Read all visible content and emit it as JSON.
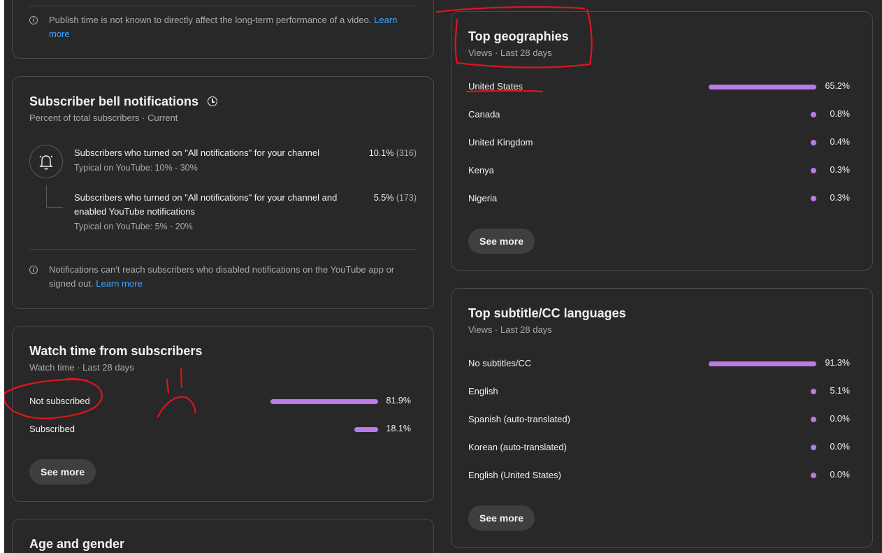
{
  "publish_card": {
    "info_text": "Publish time is not known to directly affect the long-term performance of a video.",
    "learn_more": "Learn more"
  },
  "bell_card": {
    "title": "Subscriber bell notifications",
    "subtitle": "Percent of total subscribers · Current",
    "rows": [
      {
        "text": "Subscribers who turned on \"All notifications\" for your channel",
        "typical": "Typical on YouTube: 10% - 30%",
        "value": "10.1%",
        "count": "(316)"
      },
      {
        "text": "Subscribers who turned on \"All notifications\" for your channel and enabled YouTube notifications",
        "typical": "Typical on YouTube: 5% - 20%",
        "value": "5.5%",
        "count": "(173)"
      }
    ],
    "info_text": "Notifications can't reach subscribers who disabled notifications on the YouTube app or signed out.",
    "learn_more": "Learn more"
  },
  "watch_card": {
    "title": "Watch time from subscribers",
    "subtitle": "Watch time · Last 28 days",
    "rows": [
      {
        "label": "Not subscribed",
        "value": "81.9%",
        "fraction": 0.819
      },
      {
        "label": "Subscribed",
        "value": "18.1%",
        "fraction": 0.181
      }
    ],
    "see_more": "See more"
  },
  "age_card": {
    "title": "Age and gender"
  },
  "geo_card": {
    "title": "Top geographies",
    "subtitle": "Views · Last 28 days",
    "rows": [
      {
        "label": "United States",
        "value": "65.2%",
        "fraction": 0.652
      },
      {
        "label": "Canada",
        "value": "0.8%",
        "fraction": 0.008
      },
      {
        "label": "United Kingdom",
        "value": "0.4%",
        "fraction": 0.004
      },
      {
        "label": "Kenya",
        "value": "0.3%",
        "fraction": 0.003
      },
      {
        "label": "Nigeria",
        "value": "0.3%",
        "fraction": 0.003
      }
    ],
    "see_more": "See more"
  },
  "subtitle_card": {
    "title": "Top subtitle/CC languages",
    "subtitle": "Views · Last 28 days",
    "rows": [
      {
        "label": "No subtitles/CC",
        "value": "91.3%",
        "fraction": 0.913
      },
      {
        "label": "English",
        "value": "5.1%",
        "fraction": 0.051
      },
      {
        "label": "Spanish (auto-translated)",
        "value": "0.0%",
        "fraction": 0.0
      },
      {
        "label": "Korean (auto-translated)",
        "value": "0.0%",
        "fraction": 0.0
      },
      {
        "label": "English (United States)",
        "value": "0.0%",
        "fraction": 0.0
      }
    ],
    "see_more": "See more"
  },
  "colors": {
    "background": "#282828",
    "bar": "#b97ce6",
    "link": "#3ea6ff",
    "annotation": "#e0141e"
  }
}
